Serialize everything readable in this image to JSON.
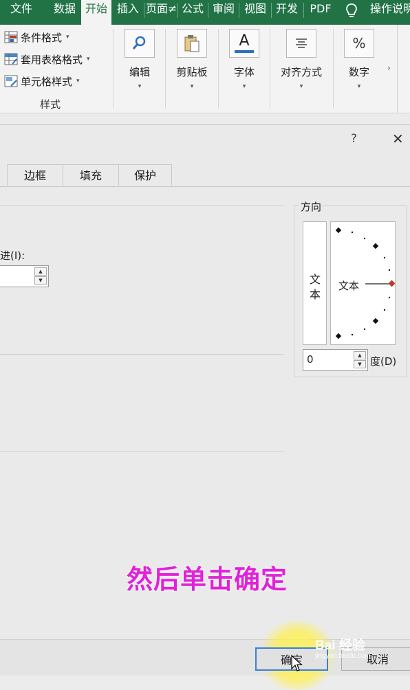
{
  "ribbon_tabs": [
    {
      "label": "文件",
      "active": false
    },
    {
      "label": "数据",
      "active": false
    },
    {
      "label": "开始",
      "active": true
    },
    {
      "label": "插入",
      "active": false
    },
    {
      "label": "页面≠",
      "active": false
    },
    {
      "label": "公式",
      "active": false
    },
    {
      "label": "审阅",
      "active": false
    },
    {
      "label": "视图",
      "active": false
    },
    {
      "label": "开发",
      "active": false
    },
    {
      "label": "PDF",
      "active": false
    },
    {
      "label": "操作说明",
      "active": false
    }
  ],
  "styles_group": {
    "conditional_format": "条件格式",
    "format_as_table": "套用表格格式",
    "cell_styles": "单元格样式",
    "group_label": "样式"
  },
  "ribbon_buttons": {
    "editing": "编辑",
    "clipboard": "剪贴板",
    "font": "字体",
    "alignment": "对齐方式",
    "number": "数字",
    "number_icon_glyph": "%",
    "font_icon_glyph": "A"
  },
  "dialog": {
    "help": "?",
    "close": "✕",
    "tabs": [
      "边框",
      "填充",
      "保护"
    ],
    "indent_label": "进(I):",
    "indent_value": "",
    "orientation": {
      "title": "方向",
      "vertical_text_1": "文",
      "vertical_text_2": "本",
      "dial_text": "文本",
      "degrees_value": "0",
      "degrees_label": "度(D)"
    },
    "ok_button": "确定",
    "cancel_button": "取消"
  },
  "caption": "然后单击确定",
  "watermark": {
    "brand": "Bai 经验",
    "url": "jingyan.baidu.com"
  },
  "colors": {
    "ribbon_green": "#217346",
    "caption_magenta": "#e022d9",
    "dial_red": "#c0392b"
  }
}
